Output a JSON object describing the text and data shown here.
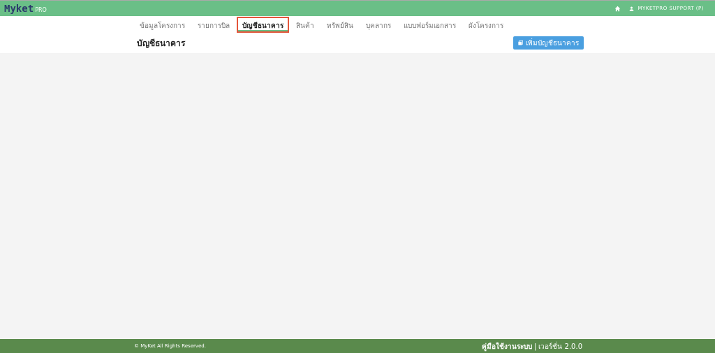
{
  "header": {
    "logo": "Myket",
    "logo_sub": "PRO",
    "user": "MYKETPRO SUPPORT (P)"
  },
  "tabs": [
    {
      "label": "ข้อมูลโครงการ",
      "selected": false
    },
    {
      "label": "รายการบิล",
      "selected": false
    },
    {
      "label": "บัญชีธนาคาร",
      "selected": true
    },
    {
      "label": "สินค้า",
      "selected": false
    },
    {
      "label": "ทรัพย์สิน",
      "selected": false
    },
    {
      "label": "บุคลากร",
      "selected": false
    },
    {
      "label": "แบบฟอร์มเอกสาร",
      "selected": false
    },
    {
      "label": "ผังโครงการ",
      "selected": false
    }
  ],
  "page": {
    "title": "บัญชีธนาคาร",
    "add_button": "เพิ่มบัญชีธนาคาร"
  },
  "footer": {
    "copyright": "© MyKet All Rights Reserved.",
    "manual": "คู่มือใช้งานระบบ",
    "separator": "|",
    "version": "เวอร์ชั่น 2.0.0"
  }
}
